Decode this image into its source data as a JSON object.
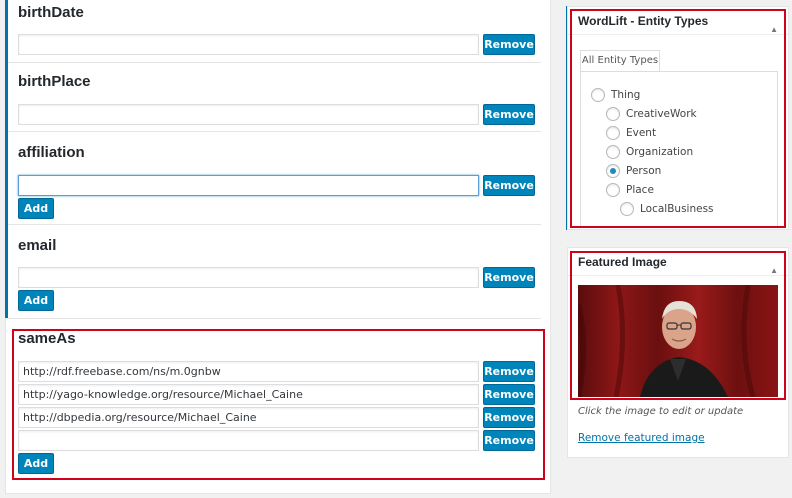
{
  "main": {
    "fields": [
      {
        "title": "birthDate",
        "values": [
          ""
        ],
        "remove_label": "Remove"
      },
      {
        "title": "birthPlace",
        "values": [
          ""
        ],
        "remove_label": "Remove"
      },
      {
        "title": "affiliation",
        "values": [
          ""
        ],
        "remove_label": "Remove",
        "add_label": "Add"
      },
      {
        "title": "email",
        "values": [
          ""
        ],
        "remove_label": "Remove",
        "add_label": "Add"
      },
      {
        "title": "sameAs",
        "values": [
          "http://rdf.freebase.com/ns/m.0gnbw",
          "http://yago-knowledge.org/resource/Michael_Caine",
          "http://dbpedia.org/resource/Michael_Caine",
          ""
        ],
        "remove_label": "Remove",
        "add_label": "Add"
      }
    ]
  },
  "sidebar": {
    "entity_types": {
      "title": "WordLift - Entity Types",
      "tab_label": "All Entity Types",
      "options": [
        {
          "label": "Thing",
          "checked": false
        },
        {
          "label": "CreativeWork",
          "checked": false
        },
        {
          "label": "Event",
          "checked": false
        },
        {
          "label": "Organization",
          "checked": false
        },
        {
          "label": "Person",
          "checked": true
        },
        {
          "label": "Place",
          "checked": false
        },
        {
          "label": "LocalBusiness",
          "checked": false
        }
      ]
    },
    "featured_image": {
      "title": "Featured Image",
      "caption": "Click the image to edit or update",
      "remove_link": "Remove featured image"
    }
  },
  "colors": {
    "accent": "#0073aa",
    "button": "#0085ba",
    "highlight": "#d0021b"
  }
}
